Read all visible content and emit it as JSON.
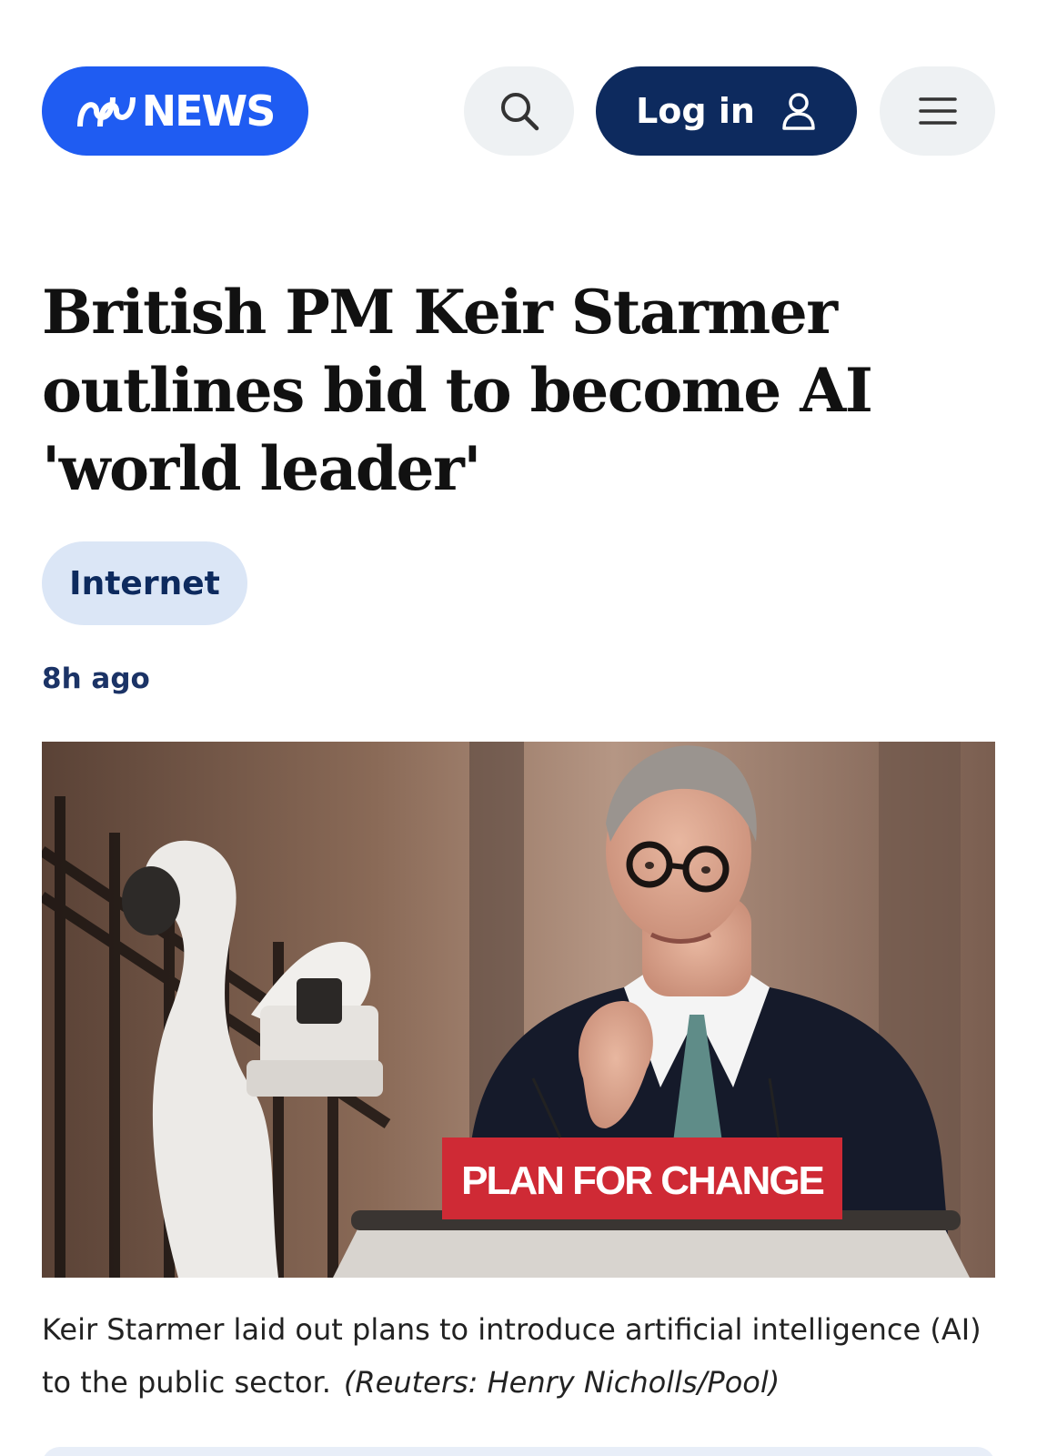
{
  "header": {
    "logo_text": "NEWS",
    "logo_name": "ABC NEWS",
    "login_label": "Log in",
    "icons": {
      "search": "search-icon",
      "user": "user-icon",
      "menu": "hamburger-menu-icon"
    },
    "colors": {
      "brand": "#1f5cf2",
      "login_bg": "#0d2a5e",
      "icon_bg": "#eef1f3"
    }
  },
  "article": {
    "headline": "British PM Keir Starmer outlines bid to become AI 'world leader'",
    "topic": "Internet",
    "timestamp": "8h ago",
    "image": {
      "podium_sign": "PLAN FOR CHANGE"
    },
    "caption": "Keir Starmer laid out plans to introduce artificial intelligence (AI) to the public sector.",
    "credit": "(Reuters: Henry Nicholls/Pool)"
  }
}
